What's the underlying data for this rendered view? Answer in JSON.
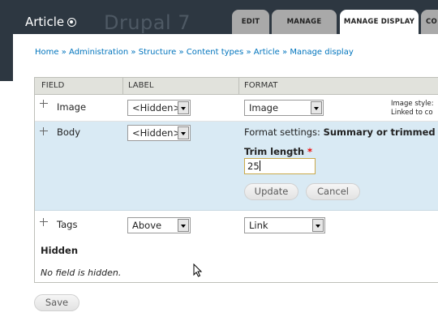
{
  "header": {
    "title": "Article",
    "watermark": "Drupal 7",
    "tabs": [
      {
        "label": "EDIT",
        "active": false
      },
      {
        "label": "MANAGE FIELDS",
        "active": false
      },
      {
        "label": "MANAGE DISPLAY",
        "active": true
      },
      {
        "label": "CO",
        "active": false
      }
    ]
  },
  "breadcrumb": [
    "Home",
    "Administration",
    "Structure",
    "Content types",
    "Article",
    "Manage display"
  ],
  "breadcrumb_separator": "»",
  "table": {
    "headers": {
      "field": "FIELD",
      "label": "LABEL",
      "format": "FORMAT"
    },
    "rows": {
      "image": {
        "name": "Image",
        "label": "<Hidden>",
        "format": "Image",
        "summary_line1": "Image style:",
        "summary_line2": "Linked to co"
      },
      "body": {
        "name": "Body",
        "label": "<Hidden>",
        "format_settings_prefix": "Format settings:",
        "format_settings_value": "Summary or trimmed",
        "trim_label": "Trim length",
        "trim_required": "*",
        "trim_value": "25",
        "update_button": "Update",
        "cancel_button": "Cancel"
      },
      "tags": {
        "name": "Tags",
        "label": "Above",
        "format": "Link"
      }
    },
    "hidden_heading": "Hidden",
    "hidden_message": "No field is hidden."
  },
  "save_button": "Save",
  "colors": {
    "header_bg": "#2d3741",
    "link": "#0074bd",
    "selected_row": "#d9eaf4",
    "table_header": "#e1e2dc"
  }
}
